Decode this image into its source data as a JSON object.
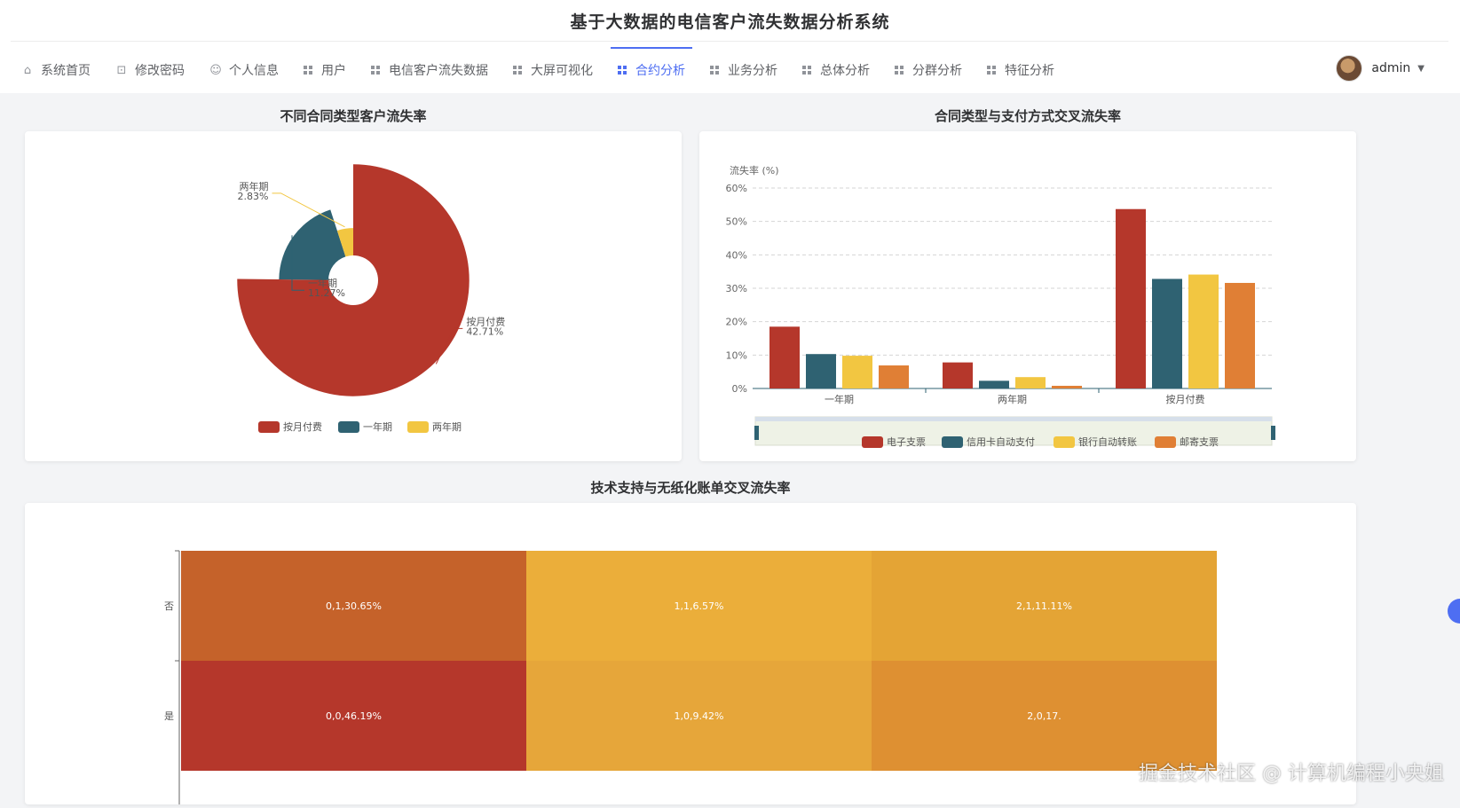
{
  "app": {
    "title": "基于大数据的电信客户流失数据分析系统"
  },
  "nav": [
    {
      "label": "系统首页",
      "icon": "home-icon",
      "active": false
    },
    {
      "label": "修改密码",
      "icon": "lock-icon",
      "active": false
    },
    {
      "label": "个人信息",
      "icon": "user-icon",
      "active": false
    },
    {
      "label": "用户",
      "icon": "grid-icon",
      "active": false
    },
    {
      "label": "电信客户流失数据",
      "icon": "grid-icon",
      "active": false
    },
    {
      "label": "大屏可视化",
      "icon": "grid-icon",
      "active": false
    },
    {
      "label": "合约分析",
      "icon": "grid-icon",
      "active": true
    },
    {
      "label": "业务分析",
      "icon": "grid-icon",
      "active": false
    },
    {
      "label": "总体分析",
      "icon": "grid-icon",
      "active": false
    },
    {
      "label": "分群分析",
      "icon": "grid-icon",
      "active": false
    },
    {
      "label": "特征分析",
      "icon": "grid-icon",
      "active": false
    }
  ],
  "user": {
    "name": "admin"
  },
  "panels": {
    "pie_title": "不同合同类型客户流失率",
    "bar_title": "合同类型与支付方式交叉流失率",
    "heat_title": "技术支持与无纸化账单交叉流失率"
  },
  "colors": {
    "accent": "#4e6ef2",
    "red": "#b5372b",
    "teal": "#2f6272",
    "yellow": "#f2c641",
    "orange": "#e07f35"
  },
  "watermark": "掘金技术社区 @ 计算机编程小央姐",
  "chart_data": [
    {
      "type": "pie",
      "variant": "rose",
      "title": "不同合同类型客户流失率",
      "slices": [
        {
          "name": "按月付费",
          "value": 42.71,
          "label": "42.71%",
          "color": "#b5372b"
        },
        {
          "name": "一年期",
          "value": 11.27,
          "label": "11.27%",
          "color": "#2f6272"
        },
        {
          "name": "两年期",
          "value": 2.83,
          "label": "2.83%",
          "color": "#f2c641"
        }
      ],
      "legend": [
        "按月付费",
        "一年期",
        "两年期"
      ],
      "legend_position": "bottom"
    },
    {
      "type": "bar",
      "title": "合同类型与支付方式交叉流失率",
      "ylabel": "流失率 (%)",
      "ylim": [
        0,
        60
      ],
      "yticks": [
        "0%",
        "10%",
        "20%",
        "30%",
        "40%",
        "50%",
        "60%"
      ],
      "categories": [
        "一年期",
        "两年期",
        "按月付费"
      ],
      "series": [
        {
          "name": "电子支票",
          "values": [
            18.5,
            7.8,
            53.7
          ],
          "color": "#b5372b"
        },
        {
          "name": "信用卡自动支付",
          "values": [
            10.3,
            2.3,
            32.8
          ],
          "color": "#2f6272"
        },
        {
          "name": "银行自动转账",
          "values": [
            9.8,
            3.4,
            34.1
          ],
          "color": "#f2c641"
        },
        {
          "name": "邮寄支票",
          "values": [
            6.9,
            0.8,
            31.6
          ],
          "color": "#e07f35"
        }
      ],
      "grid": true,
      "legend_position": "bottom",
      "datazoom": true
    },
    {
      "type": "heatmap",
      "title": "技术支持与无纸化账单交叉流失率",
      "y_categories": [
        "否",
        "是"
      ],
      "cells": [
        {
          "x": 0,
          "y": 0,
          "value": 30.65,
          "label": "0,1,30.65%",
          "color": "#c5622a"
        },
        {
          "x": 1,
          "y": 0,
          "value": 6.57,
          "label": "1,1,6.57%",
          "color": "#ebae3a"
        },
        {
          "x": 2,
          "y": 0,
          "value": 11.11,
          "label": "2,1,11.11%",
          "color": "#e4a435"
        },
        {
          "x": 0,
          "y": 1,
          "value": 46.19,
          "label": "0,0,46.19%",
          "color": "#b5372b"
        },
        {
          "x": 1,
          "y": 1,
          "value": 9.42,
          "label": "1,0,9.42%",
          "color": "#e6a63a"
        },
        {
          "x": 2,
          "y": 1,
          "value": 17,
          "label": "2,0,17.",
          "color": "#de9032"
        }
      ]
    }
  ]
}
